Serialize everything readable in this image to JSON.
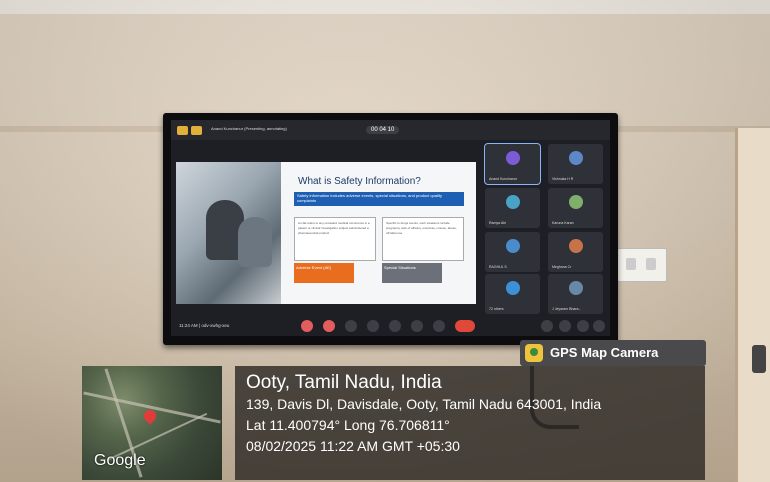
{
  "meeting": {
    "presenting_label": "Anand Kunchanur (Presenting, annotating)",
    "timer": "00 04 10",
    "clock": "11:24 AM  |  odv-xwhg-xeu"
  },
  "slide": {
    "title": "What is Safety Information?",
    "subtitle": "Safety information includes adverse events, special situations, and product quality complaints",
    "box_left": "An AE refers to any untoward medical occurrence in a patient or clinical investigation subject administered a pharmaceutical product",
    "box_right": "Specific to drugs events, such situations include pregnancy, lack of efficacy, overdose, misuse, abuse, off-label use",
    "adverse_label": "Adverse Event (AE)",
    "special_label": "Special Situations"
  },
  "participants": [
    {
      "name": "Anand Kunchanur",
      "color": "#7b5cd6"
    },
    {
      "name": "Vishnuka H R",
      "color": "#5c88c8"
    },
    {
      "name": "Ramya Abi",
      "color": "#4aa3c7"
    },
    {
      "name": "Karuna Karan",
      "color": "#7fb06b"
    },
    {
      "name": "RAGHUL S",
      "color": "#4a8ccb"
    },
    {
      "name": "Meghana Cr",
      "color": "#c7734a"
    },
    {
      "name": "72 others",
      "color": "#3b90d8"
    },
    {
      "name": "J Jeyaram Bhara...",
      "color": "#6b87a8"
    }
  ],
  "stamp": {
    "app_name": "GPS Map Camera",
    "location_title": "Ooty, Tamil Nadu, India",
    "address": "139, Davis Dl, Davisdale, Ooty, Tamil Nadu 643001, India",
    "coords": "Lat 11.400794° Long 76.706811°",
    "datetime": "08/02/2025 11:22 AM GMT +05:30",
    "map_brand": "Google"
  }
}
